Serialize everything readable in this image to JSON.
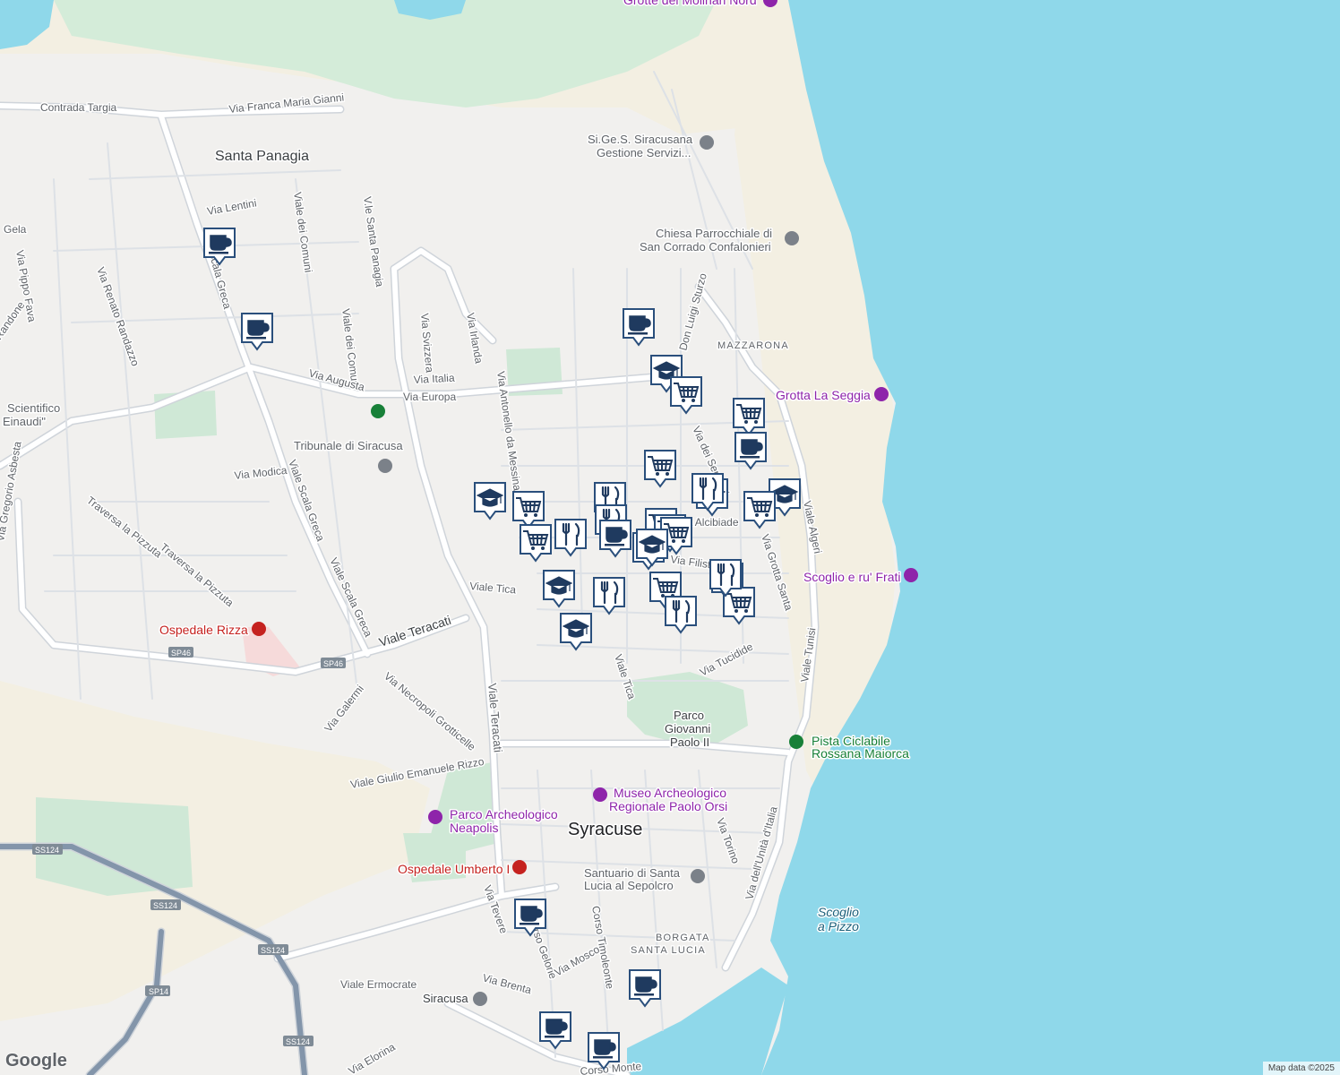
{
  "colors": {
    "land": "#f1f0ee",
    "water": "#8fd8ea",
    "park": "#cfe8d6",
    "beige": "#f3efe2",
    "road": "#ffffff",
    "road_casing": "#cfd4da",
    "marker_bg": "#ffffff",
    "marker_border": "#2a4f7c",
    "marker_icon": "#1f3a5f"
  },
  "labels": {
    "grotte_molinari": "Grotte dei Molinari Nord",
    "contrada_targia": "Contrada Targia",
    "via_franca": "Via Franca Maria Gianni",
    "santa_panagia": "Santa Panagia",
    "siges_1": "Si.Ge.S. Siracusana",
    "siges_2": "Gestione Servizi...",
    "chiesa_1": "Chiesa Parrocchiale di",
    "chiesa_2": "San Corrado Confalonieri",
    "via_lentini": "Via Lentini",
    "gela": "Gela",
    "via_pippo_fava": "Via Pippo Fava",
    "via_renato_randazzo": "Via Renato Randazzo",
    "randone": "Randone",
    "viale_dei_comuni_1": "Viale dei Comuni",
    "viale_dei_comuni_2": "Viale dei Comuni",
    "viale_santa_panagia": "V.le Santa Panagia",
    "via_svizzera": "Via Svizzera",
    "via_irlanda": "Via Irlanda",
    "don_luigi_sturzo": "Don Luigi Sturzo",
    "mazzarona": "MAZZARONA",
    "grotta_la_seggia": "Grotta La Seggia",
    "via_italia": "Via Italia",
    "via_augusta": "Via Augusta",
    "via_europa": "Via Europa",
    "liceo_1": "Scientifico",
    "liceo_2": "Einaudi\"",
    "tribunale": "Tribunale di Siracusa",
    "via_antonello": "Via Antonello da Messina",
    "via_dei_sepolcri": "Via dei Sepolcri",
    "viale_algeri": "Viale Algeri",
    "via_modica": "Via Modica",
    "via_gregorio_asbesta": "Via Gregorio Asbesta",
    "viale_scala_greca_1": "Viale Scala Greca",
    "viale_scala_greca_2": "Viale Scala Greca",
    "viale_scala_greca_3": "Via Scala Greca",
    "traversa_pizzuta_1": "Traversa la Pizzuta",
    "traversa_pizzuta_2": "Traversa la Pizzuta",
    "via_alcibiade": "Via Alcibiade",
    "via_filisto": "Via Filisto",
    "via_grotta_santa": "Via Grotta Santa",
    "scoglio_frati": "Scoglio e ru' Frati",
    "viale_tica_1": "Viale Tica",
    "viale_tica_2": "Viale Tica",
    "ospedale_rizza": "Ospedale Rizza",
    "viale_teracati_1": "Viale Teracati",
    "viale_teracati_2": "Viale Teracati",
    "sp46_1": "SP46",
    "sp46_2": "SP46",
    "viale_tunisi": "Viale Tunisi",
    "via_tucidide": "Via Tucidide",
    "via_necropoli": "Via Necropoli Grotticelle",
    "via_galermi": "Via Galermi",
    "parco_1": "Parco",
    "parco_2": "Giovanni",
    "parco_3": "Paolo II",
    "pista_1": "Pista Ciclabile",
    "pista_2": "Rossana Maiorca",
    "viale_giulio": "Viale Giulio Emanuele Rizzo",
    "museo_1": "Museo Archeologico",
    "museo_2": "Regionale Paolo Orsi",
    "parco_arch_1": "Parco Archeologico",
    "parco_arch_2": "Neapolis",
    "syracuse": "Syracuse",
    "via_torino": "Via Torino",
    "via_unita": "Via dell'Unità d'Italia",
    "ss124_1": "SS124",
    "ss124_2": "SS124",
    "ss124_3": "SS124",
    "ss124_4": "SS124",
    "ospedale_umberto": "Ospedale Umberto I",
    "santuario_1": "Santuario di Santa",
    "santuario_2": "Lucia al Sepolcro",
    "scoglio_pizzo_1": "Scoglio",
    "scoglio_pizzo_2": "a Pizzo",
    "via_tevere": "Via Tevere",
    "corso_gelone": "Corso Gelone",
    "corso_timoleonte": "Corso Timoleonte",
    "borgata_1": "BORGATA",
    "borgata_2": "SANTA LUCIA",
    "via_mosco": "Via Mosco",
    "via_brenta": "Via Brenta",
    "viale_ermocrate": "Viale Ermocrate",
    "sp14": "SP14",
    "siracusa_station": "Siracusa",
    "via_elorina": "Via Elorina",
    "corso_monte": "Corso Monte"
  },
  "markers": [
    {
      "type": "coffee",
      "name": "coffee-marker-1"
    },
    {
      "type": "coffee",
      "name": "coffee-marker-2"
    },
    {
      "type": "coffee",
      "name": "coffee-marker-3"
    },
    {
      "type": "school",
      "name": "school-marker-1"
    },
    {
      "type": "cart",
      "name": "cart-marker-1"
    },
    {
      "type": "cart",
      "name": "cart-marker-2"
    },
    {
      "type": "coffee",
      "name": "coffee-marker-4"
    },
    {
      "type": "cart",
      "name": "cart-marker-3"
    },
    {
      "type": "restaurant",
      "name": "restaurant-marker-1"
    },
    {
      "type": "school",
      "name": "school-marker-2"
    },
    {
      "type": "restaurant",
      "name": "restaurant-marker-2"
    },
    {
      "type": "cart",
      "name": "cart-marker-4"
    },
    {
      "type": "school",
      "name": "school-marker-3"
    },
    {
      "type": "school",
      "name": "school-marker-4"
    },
    {
      "type": "cart",
      "name": "cart-marker-5"
    },
    {
      "type": "cart",
      "name": "cart-marker-6"
    },
    {
      "type": "cart",
      "name": "cart-marker-7"
    },
    {
      "type": "restaurant",
      "name": "restaurant-marker-3"
    },
    {
      "type": "restaurant",
      "name": "restaurant-marker-4"
    },
    {
      "type": "cart",
      "name": "cart-marker-8"
    },
    {
      "type": "cart",
      "name": "cart-marker-9"
    },
    {
      "type": "coffee",
      "name": "coffee-marker-5"
    },
    {
      "type": "cart",
      "name": "cart-marker-10"
    },
    {
      "type": "school",
      "name": "school-marker-5"
    },
    {
      "type": "cart",
      "name": "cart-marker-11"
    },
    {
      "type": "restaurant",
      "name": "restaurant-marker-5"
    },
    {
      "type": "school",
      "name": "school-marker-6"
    },
    {
      "type": "restaurant",
      "name": "restaurant-marker-6"
    },
    {
      "type": "cart",
      "name": "cart-marker-12"
    },
    {
      "type": "cart",
      "name": "cart-marker-13"
    },
    {
      "type": "restaurant",
      "name": "restaurant-marker-7"
    },
    {
      "type": "school",
      "name": "school-marker-7"
    },
    {
      "type": "coffee",
      "name": "coffee-marker-6"
    },
    {
      "type": "coffee",
      "name": "coffee-marker-7"
    },
    {
      "type": "coffee",
      "name": "coffee-marker-8"
    },
    {
      "type": "coffee",
      "name": "coffee-marker-9"
    }
  ],
  "footer": {
    "logo": "Google",
    "attribution": "Map data ©2025"
  }
}
